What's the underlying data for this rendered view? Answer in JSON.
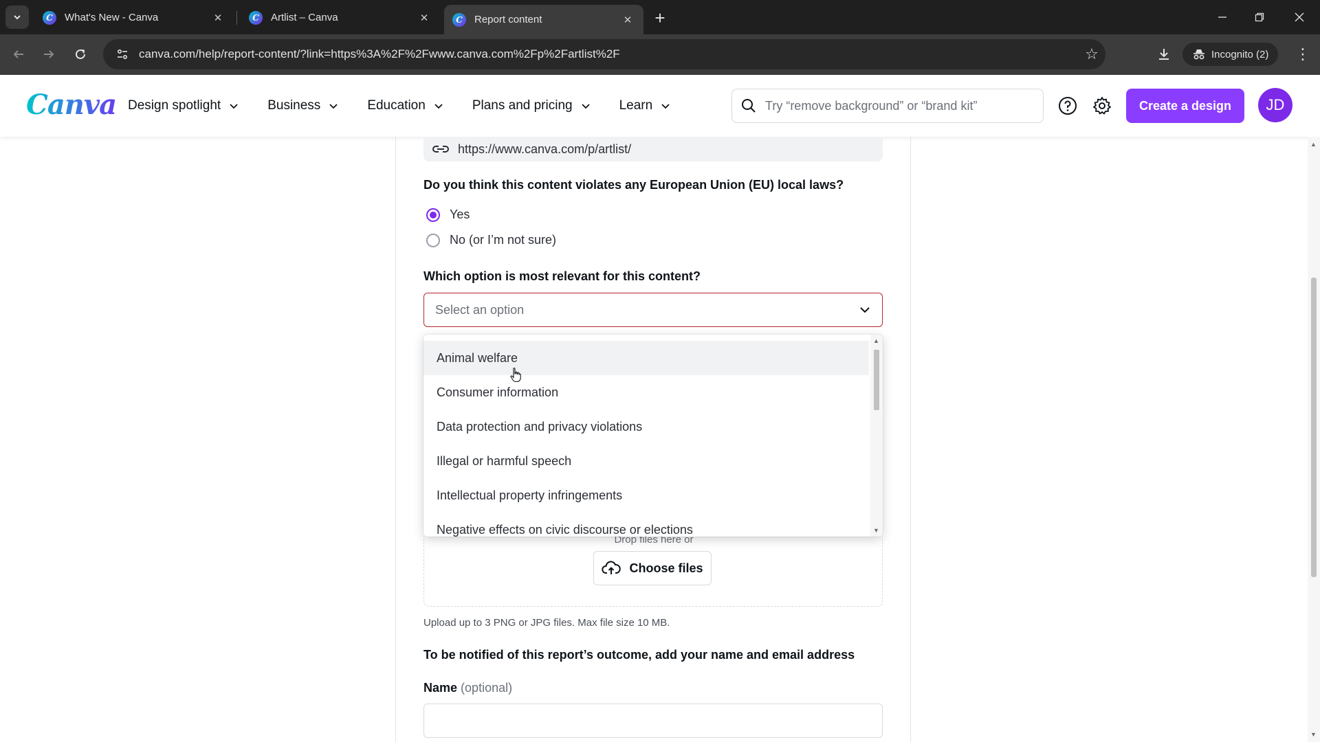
{
  "browser": {
    "tabs": [
      {
        "title": "What's New - Canva",
        "active": false
      },
      {
        "title": "Artlist – Canva",
        "active": false
      },
      {
        "title": "Report content",
        "active": true
      }
    ],
    "url": "canva.com/help/report-content/?link=https%3A%2F%2Fwww.canva.com%2Fp%2Fartlist%2F",
    "incognito_label": "Incognito (2)"
  },
  "header": {
    "logo": "Canva",
    "nav": [
      {
        "label": "Design spotlight"
      },
      {
        "label": "Business"
      },
      {
        "label": "Education"
      },
      {
        "label": "Plans and pricing"
      },
      {
        "label": "Learn"
      }
    ],
    "search_placeholder": "Try “remove background” or “brand kit”",
    "create_button": "Create a design",
    "avatar_initials": "JD",
    "accent_color": "#8b3dff"
  },
  "form": {
    "reported_link": "https://www.canva.com/p/artlist/",
    "eu_question": "Do you think this content violates any European Union (EU) local laws?",
    "eu_options": [
      {
        "label": "Yes",
        "checked": true
      },
      {
        "label": "No (or I’m not sure)",
        "checked": false
      }
    ],
    "relevance_question": "Which option is most relevant for this content?",
    "select_placeholder": "Select an option",
    "dropdown_options": [
      "Animal welfare",
      "Consumer information",
      "Data protection and privacy violations",
      "Illegal or harmful speech",
      "Intellectual property infringements",
      "Negative effects on civic discourse or elections"
    ],
    "drop_hint": "Drop files here or",
    "choose_files": "Choose files",
    "upload_note": "Upload up to 3 PNG or JPG files. Max file size 10 MB.",
    "notify_label": "To be notified of this report’s outcome, add your name and email address",
    "name_label": "Name",
    "name_optional": "(optional)"
  }
}
